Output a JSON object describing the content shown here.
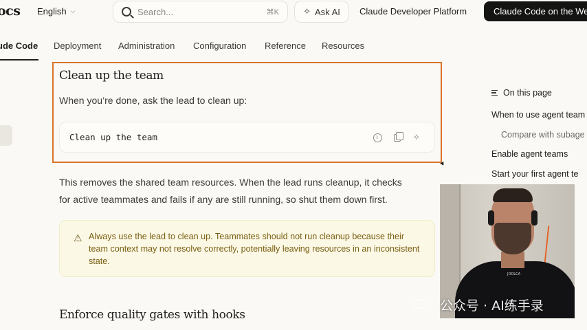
{
  "header": {
    "brand": "ocs",
    "language": "English",
    "search_placeholder": "Search...",
    "search_shortcut": "⌘K",
    "ask_ai": "Ask AI",
    "platform_link": "Claude Developer Platform",
    "cta": "Claude Code on the Web"
  },
  "tabs": [
    {
      "label": "ude Code",
      "active": true
    },
    {
      "label": "Deployment"
    },
    {
      "label": "Administration"
    },
    {
      "label": "Configuration"
    },
    {
      "label": "Reference"
    },
    {
      "label": "Resources"
    }
  ],
  "content": {
    "section1_title": "Clean up the team",
    "section1_intro": "When you’re done, ask the lead to clean up:",
    "code": "Clean up the team",
    "para_line1": "This removes the shared team resources. When the lead runs cleanup, it checks",
    "para_line2": "for active teammates and fails if any are still running, so shut them down first.",
    "callout_text": "Always use the lead to clean up. Teammates should not run cleanup because their team context may not resolve correctly, potentially leaving resources in an inconsistent state.",
    "section2_title": "Enforce quality gates with hooks"
  },
  "toc": {
    "heading": "On this page",
    "items": [
      {
        "label": "When to use agent team",
        "sub": false
      },
      {
        "label": "Compare with subage",
        "sub": true
      },
      {
        "label": "Enable agent teams",
        "sub": false
      },
      {
        "label": "Start your first agent te",
        "sub": false
      }
    ]
  },
  "overlay": {
    "watermark": "公众号 · AI练手录",
    "shirt_text": "JOOLCA"
  },
  "colors": {
    "highlight_border": "#d97328",
    "callout_bg": "#fbf8e6",
    "callout_text": "#7a5f12",
    "cta_bg": "#141413"
  }
}
